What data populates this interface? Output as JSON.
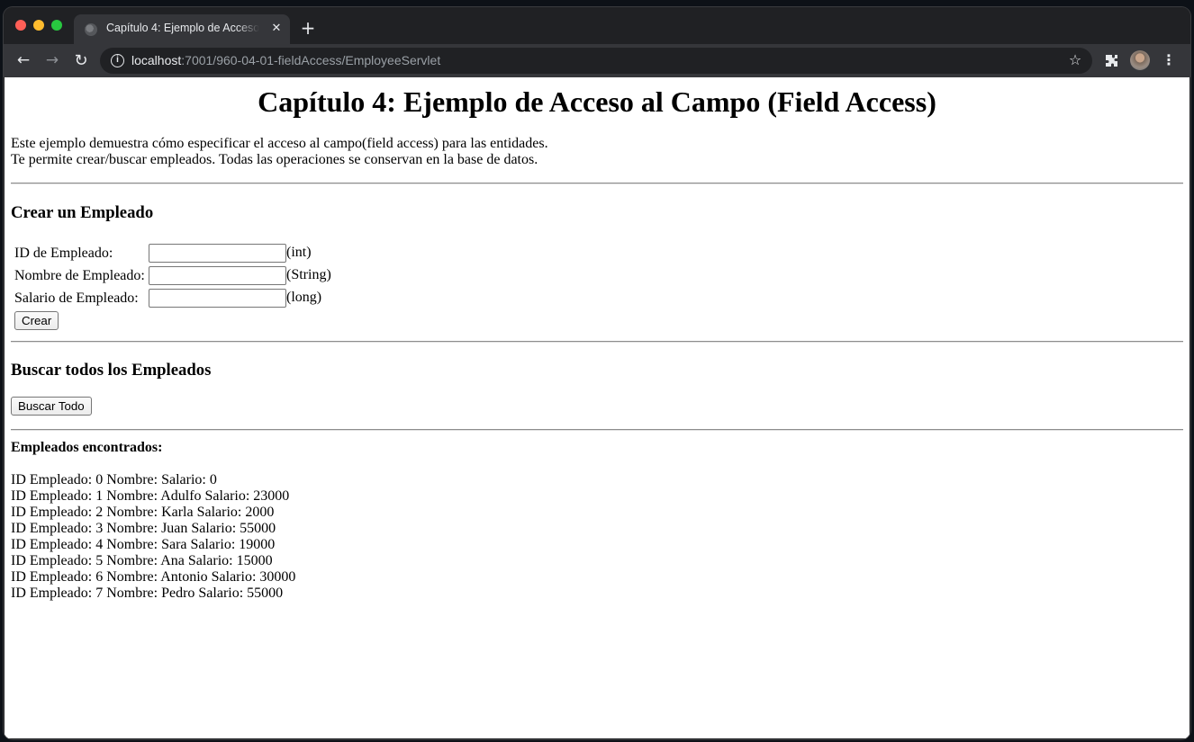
{
  "browser": {
    "tab_title": "Capítulo 4: Ejemplo de Acceso al Campo (Field Access)",
    "url_host": "localhost",
    "url_path": ":7001/960-04-01-fieldAccess/EmployeeServlet",
    "icons": {
      "close": "close-icon",
      "new_tab": "plus-icon",
      "back": "arrow-left-icon",
      "forward": "arrow-right-icon",
      "reload": "reload-icon",
      "info": "info-icon",
      "bookmark": "star-icon",
      "extensions": "puzzle-icon",
      "menu": "kebab-menu-icon"
    }
  },
  "page": {
    "title": "Capítulo 4: Ejemplo de Acceso al Campo (Field Access)",
    "intro_line1": "Este ejemplo demuestra cómo especificar el acceso al campo(field access) para las entidades.",
    "intro_line2": "Te permite crear/buscar empleados. Todas las operaciones se conservan en la base de datos.",
    "create_heading": "Crear un Empleado",
    "form": {
      "fields": [
        {
          "label": "ID de Empleado:",
          "value": "",
          "type_hint": "(int)"
        },
        {
          "label": "Nombre de Empleado:",
          "value": "",
          "type_hint": "(String)"
        },
        {
          "label": "Salario de Empleado:",
          "value": "",
          "type_hint": "(long)"
        }
      ],
      "submit_label": "Crear"
    },
    "search_heading": "Buscar todos los Empleados",
    "search_button_label": "Buscar Todo",
    "found_heading": "Empleados encontrados:",
    "results": [
      "ID Empleado: 0 Nombre: Salario: 0",
      "ID Empleado: 1 Nombre: Adulfo Salario: 23000",
      "ID Empleado: 2 Nombre: Karla Salario: 2000",
      "ID Empleado: 3 Nombre: Juan Salario: 55000",
      "ID Empleado: 4 Nombre: Sara Salario: 19000",
      "ID Empleado: 5 Nombre: Ana Salario: 15000",
      "ID Empleado: 6 Nombre: Antonio Salario: 30000",
      "ID Empleado: 7 Nombre: Pedro Salario: 55000"
    ]
  }
}
